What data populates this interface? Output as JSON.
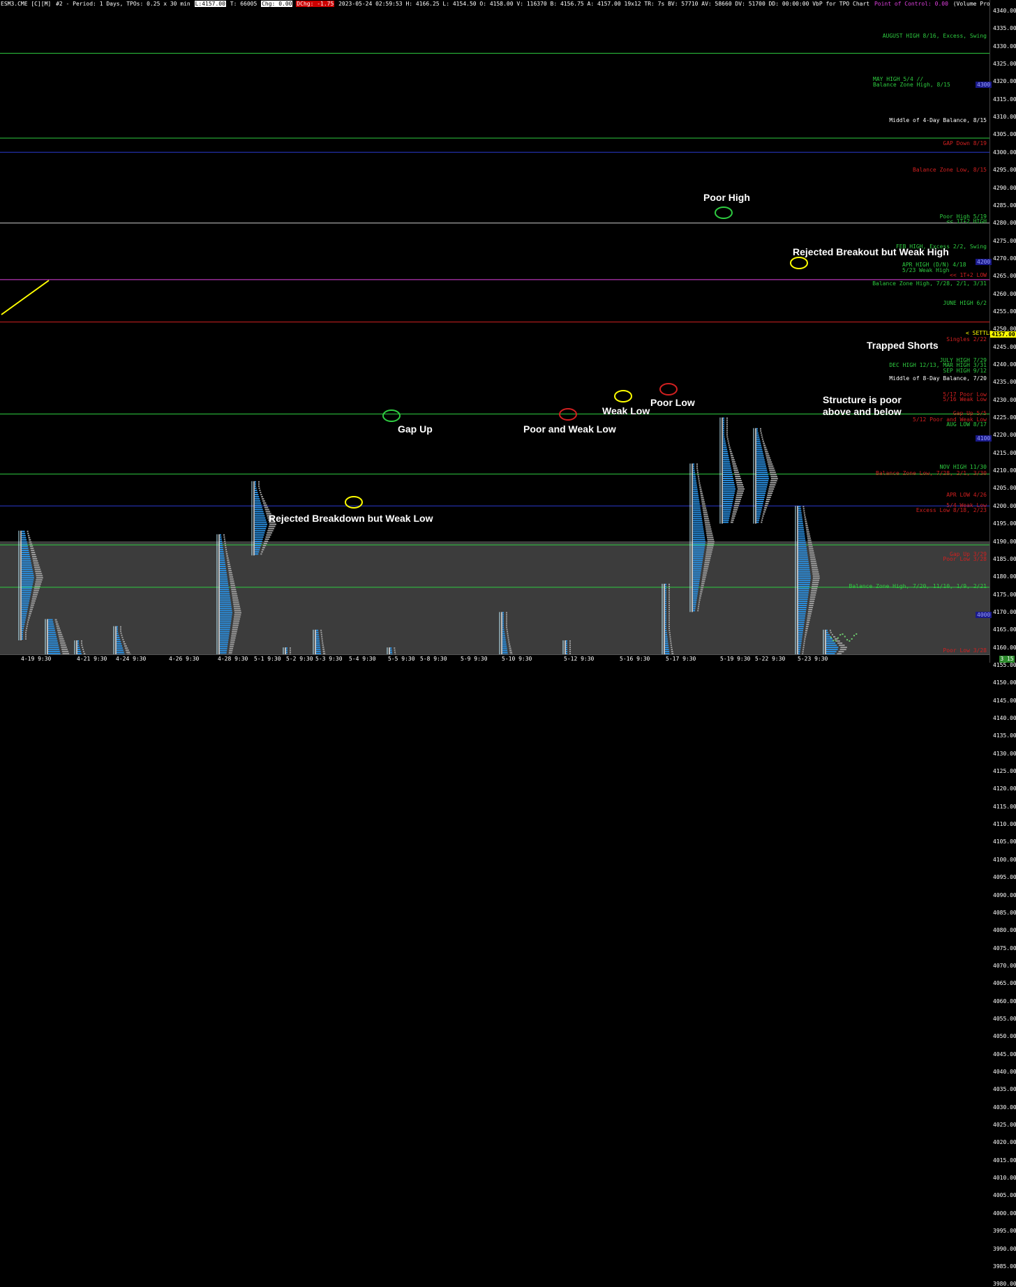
{
  "status_bar": {
    "symbol": "ESM3.CME [C][M]",
    "chart_info": "#2 - Period: 1 Days, TPOs: 0.25 x 30 min",
    "last": "L:4157.00",
    "total": "T: 66005",
    "chg": "Chg: 0.00",
    "dchg": "DChg: -1.75",
    "stats": "2023-05-24 02:59:53 H: 4166.25 L: 4154.50 O: 4158.00 V: 116370 B: 4156.75 A: 4157.00 19x12 TR: 7s BV: 57710 AV: 58660 DV: 51700 DD: 00:00:00 VbP for TPO Chart",
    "poc": "Point of Control: 0.00",
    "study": "(Volume Profiles, 0, 1, Based On TPO Chart, No, Days, 1, 50, 1000000, 0, 0, No, 00:00:00, 0, 0"
  },
  "price_axis": {
    "ticks": [
      "4340.00",
      "4335.00",
      "4330.00",
      "4325.00",
      "4320.00",
      "4315.00",
      "4310.00",
      "4305.00",
      "4300.00",
      "4295.00",
      "4290.00",
      "4285.00",
      "4280.00",
      "4275.00",
      "4270.00",
      "4265.00",
      "4260.00",
      "4255.00",
      "4250.00",
      "4245.00",
      "4240.00",
      "4235.00",
      "4230.00",
      "4225.00",
      "4220.00",
      "4215.00",
      "4210.00",
      "4205.00",
      "4200.00",
      "4195.00",
      "4190.00",
      "4185.00",
      "4180.00",
      "4175.00",
      "4170.00",
      "4165.00",
      "4160.00",
      "4155.00",
      "4150.00",
      "4145.00",
      "4140.00",
      "4135.00",
      "4130.00",
      "4125.00",
      "4120.00",
      "4115.00",
      "4110.00",
      "4105.00",
      "4100.00",
      "4095.00",
      "4090.00",
      "4085.00",
      "4080.00",
      "4075.00",
      "4070.00",
      "4065.00",
      "4060.00",
      "4055.00",
      "4050.00",
      "4045.00",
      "4040.00",
      "4035.00",
      "4030.00",
      "4025.00",
      "4020.00",
      "4015.00",
      "4010.00",
      "4005.00",
      "4000.00",
      "3995.00",
      "3990.00",
      "3985.00",
      "3980.00"
    ],
    "settle_label": "< SETTLE",
    "last_price": "4157.00",
    "level_tags": [
      "4300",
      "4200",
      "4100",
      "4000"
    ]
  },
  "time_axis": {
    "labels": [
      "4-19 9:30",
      "4-21 9:30",
      "4-24 9:30",
      "4-26 9:30",
      "4-28 9:30",
      "5-1 9:30",
      "5-2 9:30",
      "5-3 9:30",
      "5-4 9:30",
      "5-5 9:30",
      "5-8 9:30",
      "5-9 9:30",
      "5-10 9:30",
      "5-12 9:30",
      "5-16 9:30",
      "5-17 9:30",
      "5-19 9:30",
      "5-22 9:30",
      "5-23 9:30"
    ],
    "corner_badge": "3 15"
  },
  "level_labels": {
    "aug_high": "AUGUST HIGH 8/16, Excess, Swing",
    "may_high": "MAY HIGH 5/4 //",
    "bal_zone_high_815": "Balance Zone High, 8/15",
    "mid_4day": "Middle of 4-Day Balance, 8/15",
    "gap_down_819": "GAP Down 8/19",
    "bal_zone_low_815": "Balance Zone Low, 8/15",
    "poor_high_519": "Poor High 5/19",
    "one_t_high": "<< 1T+2 HIGH",
    "feb_high": "FEB HIGH, Excess 2/2, Swing",
    "apr_high": "APR HIGH (D/N) 4/18",
    "weak_high_523": "5/23 Weak High",
    "one_t_low": "<< 1T+2 LOW",
    "bal_zone_high_728": "Balance Zone High, 7/28, 2/1, 3/31",
    "june_high": "JUNE HIGH 6/2",
    "singles": "Singles 2/22",
    "july_high": "JULY HIGH 7/29",
    "dec_high": "DEC HIGH 12/13, MAR HIGH 3/31",
    "sep_high": "SEP HIGH 9/12",
    "mid_8day": "Middle of 8-Day Balance, 7/20",
    "poor_low_517": "5/17 Poor Low",
    "weak_low_516": "5/16 Weak Low",
    "gap_up_55": "Gap Up 5/5",
    "poor_weak_512": "5/12 Poor and Weak Low",
    "aug_low": "AUG LOW 8/17",
    "nov_high": "NOV HIGH 11/30",
    "bal_zone_low_728": "Balance Zone Low, 7/28, 2/1, 3/30",
    "apr_low": "APR LOW 4/26",
    "weak_low_54": "5/4 Weak Low",
    "excess_low": "Excess Low 8/18, 2/23",
    "gap_up_329": "Gap Up 3/29",
    "poor_low_328": "Poor Low 3/28",
    "bal_zone_high_720": "Balance Zone High, 7/20, 11/10, 1/9, 2/21",
    "poor_low_bottom": "Poor Low 3/28"
  },
  "annotations": {
    "poor_high": "Poor High",
    "rejected_breakout": "Rejected Breakout but Weak High",
    "trapped_shorts": "Trapped Shorts",
    "structure_poor_1": "Structure is poor",
    "structure_poor_2": "above and below",
    "gap_up": "Gap Up",
    "poor_weak_low": "Poor and Weak Low",
    "weak_low": "Weak Low",
    "poor_low": "Poor Low",
    "rejected_breakdown": "Rejected Breakdown but Weak Low"
  },
  "colors": {
    "background": "#000000",
    "gray_band": "#3c3c3c",
    "green_line": "#2ecc40",
    "red_line": "#d22020",
    "blue_line": "#2b3bd0",
    "navy_zone": "#12124a",
    "tpo_blue": "#2a8fe0",
    "volume_gray": "#9a9a9a"
  }
}
